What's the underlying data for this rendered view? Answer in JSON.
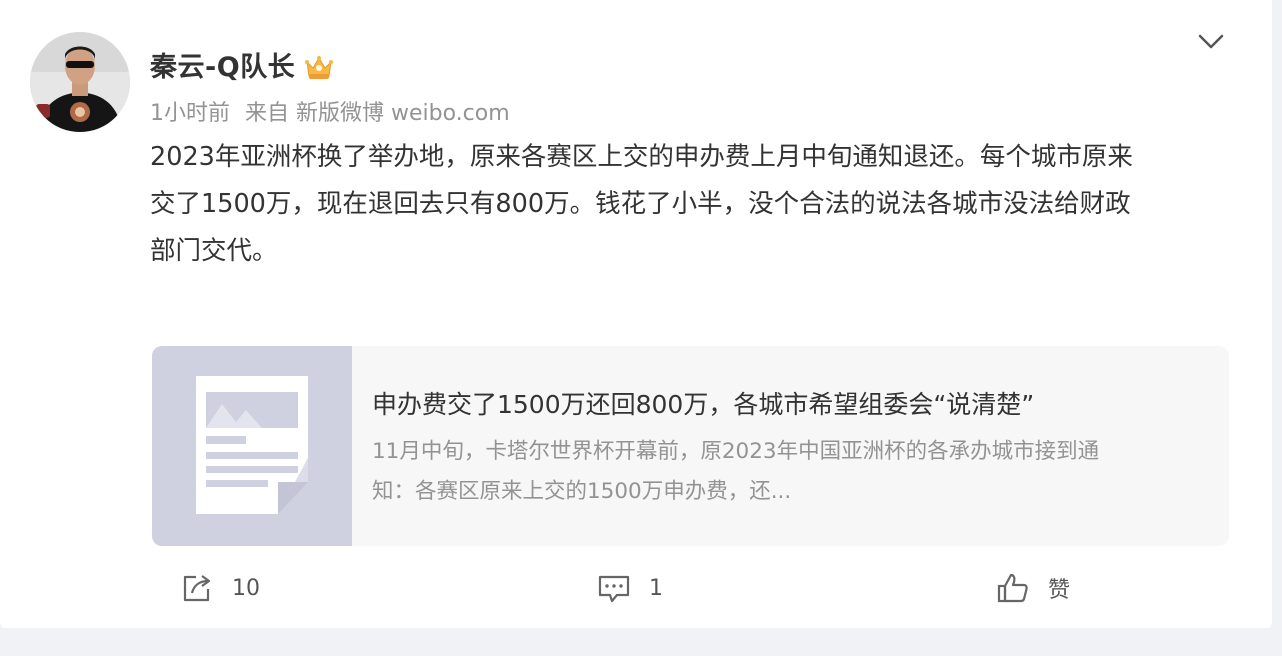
{
  "author": {
    "name": "秦云-Q队长",
    "badge_icon": "crown-badge-icon"
  },
  "meta": {
    "time": "1小时前",
    "source": "来自 新版微博 weibo.com"
  },
  "post": {
    "text_lines": [
      "2023年亚洲杯换了举办地，原来各赛区上交的申办费上月中旬通知退还。每个城市原来",
      "交了1500万，现在退回去只有800万。钱花了小半，没个合法的说法各城市没法给财政",
      "部门交代。"
    ]
  },
  "card": {
    "title": "申办费交了1500万还回800万，各城市希望组委会“说清楚”",
    "desc_lines": [
      "11月中旬，卡塔尔世界杯开幕前，原2023年中国亚洲杯的各承办城市接到通",
      "知：各赛区原来上交的1500万申办费，还..."
    ],
    "thumb_icon": "article-placeholder-icon"
  },
  "actions": {
    "repost_count": "10",
    "comment_count": "1",
    "like_label": "赞"
  },
  "colors": {
    "name": "#333333",
    "meta": "#939393",
    "card_bg": "#f7f7f7",
    "thumb_bg": "#cfd0e0",
    "page_bg": "#f1f2f5"
  }
}
